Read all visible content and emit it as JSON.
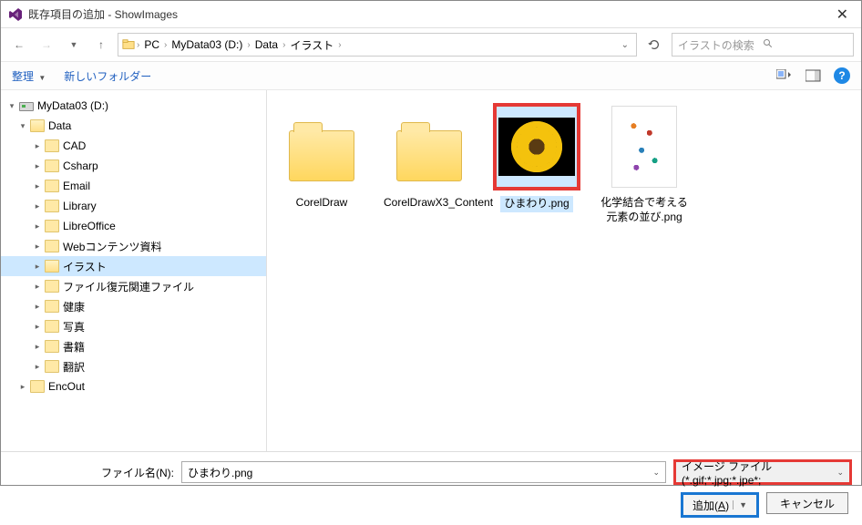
{
  "title": "既存項目の追加 - ShowImages",
  "breadcrumbs": [
    "PC",
    "MyData03 (D:)",
    "Data",
    "イラスト"
  ],
  "search_placeholder": "イラストの検索",
  "toolbar": {
    "organize": "整理",
    "new_folder": "新しいフォルダー"
  },
  "tree": {
    "root": "MyData03 (D:)",
    "data": "Data",
    "children": [
      "CAD",
      "Csharp",
      "Email",
      "Library",
      "LibreOffice",
      "Webコンテンツ資料",
      "イラスト",
      "ファイル復元関連ファイル",
      "健康",
      "写真",
      "書籍",
      "翻訳"
    ],
    "selected_index": 6,
    "encout": "EncOut"
  },
  "items": [
    {
      "name": "CorelDraw",
      "type": "folder"
    },
    {
      "name": "CorelDrawX3_Content",
      "type": "folder"
    },
    {
      "name": "ひまわり.png",
      "type": "image",
      "selected": true
    },
    {
      "name": "化学結合で考える元素の並び.png",
      "type": "image"
    }
  ],
  "filename_label": "ファイル名(N):",
  "filename_value": "ひまわり.png",
  "filter_value": "イメージ ファイル (*.gif;*.jpg;*.jpe*;",
  "buttons": {
    "add": "追加(A)",
    "cancel": "キャンセル"
  }
}
